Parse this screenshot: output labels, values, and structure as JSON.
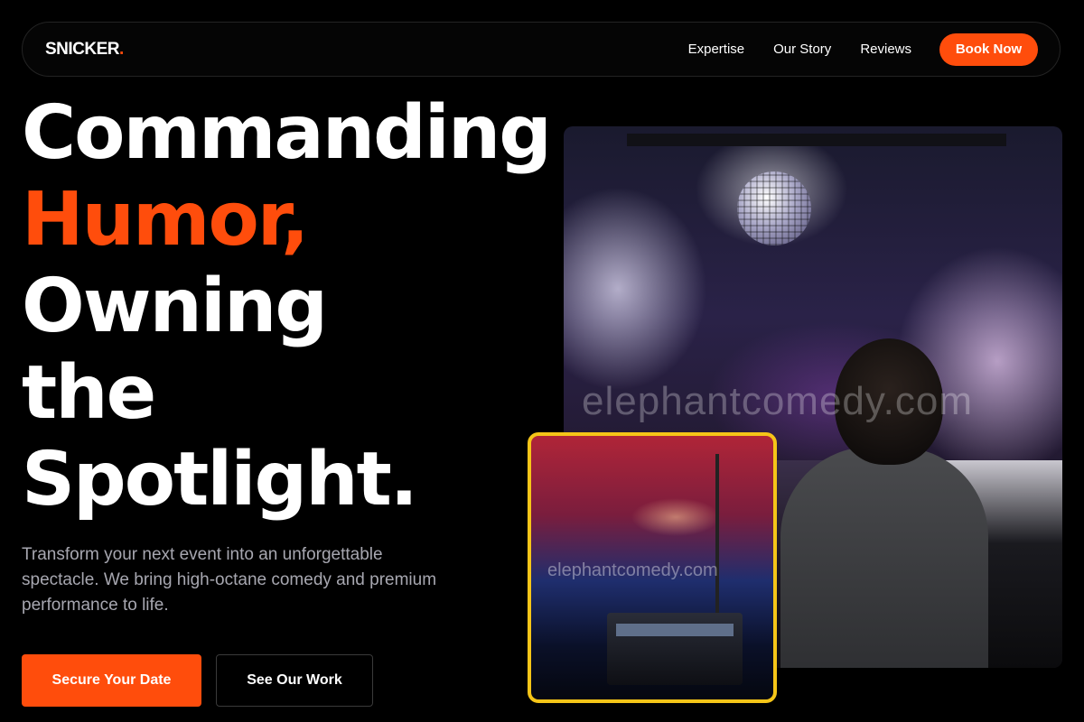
{
  "header": {
    "logo_text": "SNICKER",
    "logo_dot": ".",
    "nav": [
      "Expertise",
      "Our Story",
      "Reviews"
    ],
    "cta_label": "Book Now"
  },
  "hero": {
    "headline": [
      "Commanding",
      "Humor,",
      "Owning",
      "the",
      "Spotlight."
    ],
    "subtitle": "Transform your next event into an unforgettable spectacle. We bring high-octane comedy and premium performance to life.",
    "primary_button": "Secure Your Date",
    "secondary_button": "See Our Work"
  },
  "images": {
    "main_watermark": "elephantcomedy.com",
    "inset_watermark": "elephantcomedy.com"
  },
  "colors": {
    "accent": "#ff4d0c",
    "inset_border": "#f5c518",
    "background": "#000000",
    "subtitle": "#a7a7b0"
  }
}
